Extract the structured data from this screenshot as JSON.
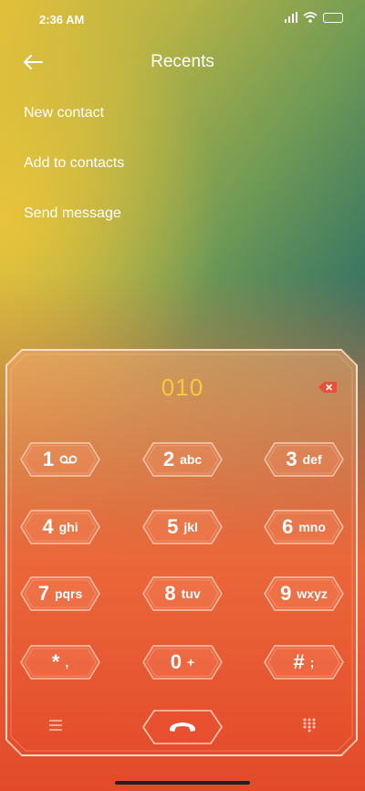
{
  "status_bar": {
    "time": "2:36 AM"
  },
  "header": {
    "title": "Recents",
    "back_icon": "back-arrow-icon"
  },
  "menu": [
    {
      "label": "New contact"
    },
    {
      "label": "Add to contacts"
    },
    {
      "label": "Send message"
    }
  ],
  "dialer": {
    "number": "010",
    "keys": [
      {
        "digit": "1",
        "letters": ""
      },
      {
        "digit": "2",
        "letters": "abc"
      },
      {
        "digit": "3",
        "letters": "def"
      },
      {
        "digit": "4",
        "letters": "ghi"
      },
      {
        "digit": "5",
        "letters": "jkl"
      },
      {
        "digit": "6",
        "letters": "mno"
      },
      {
        "digit": "7",
        "letters": "pqrs"
      },
      {
        "digit": "8",
        "letters": "tuv"
      },
      {
        "digit": "9",
        "letters": "wxyz"
      },
      {
        "digit": "*",
        "letters": ","
      },
      {
        "digit": "0",
        "letters": "+"
      },
      {
        "digit": "#",
        "letters": ";"
      }
    ]
  },
  "icons": [
    "voicemail-icon",
    "backspace-icon",
    "menu-icon",
    "call-end-icon",
    "keypad-icon"
  ],
  "colors": {
    "number": "#f6c83a",
    "backspace": "#e8503a"
  }
}
